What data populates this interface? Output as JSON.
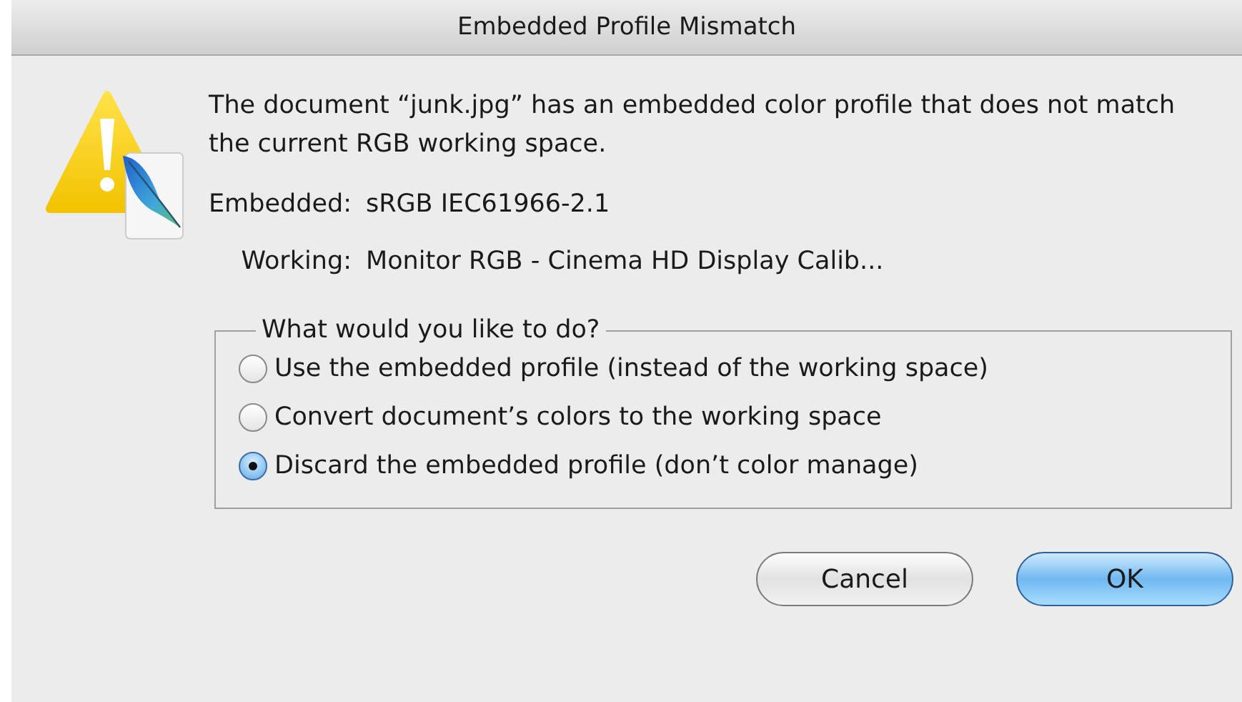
{
  "window": {
    "title": "Embedded Profile Mismatch"
  },
  "message": "The document “junk.jpg” has an embedded color profile that does not match the current RGB working space.",
  "profiles": [
    {
      "label": "Embedded:",
      "value": "sRGB IEC61966-2.1"
    },
    {
      "label": "Working:",
      "value": "Monitor RGB - Cinema HD Display Calib..."
    }
  ],
  "options_group": {
    "title": "What would you like to do?",
    "options": [
      {
        "label": "Use the embedded profile (instead of the working space)",
        "selected": false
      },
      {
        "label": "Convert document’s colors to the working space",
        "selected": false
      },
      {
        "label": "Discard the embedded profile (don’t color manage)",
        "selected": true
      }
    ]
  },
  "buttons": [
    {
      "label": "Cancel",
      "default": false
    },
    {
      "label": "OK",
      "default": true
    }
  ]
}
